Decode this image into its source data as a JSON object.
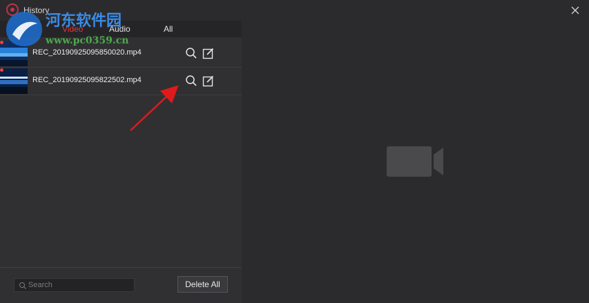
{
  "window": {
    "title": "History"
  },
  "tabs": [
    {
      "label": "Video",
      "active": true
    },
    {
      "label": "Audio",
      "active": false
    },
    {
      "label": "All",
      "active": false
    }
  ],
  "files": [
    {
      "name": "REC_20190925095850020.mp4"
    },
    {
      "name": "REC_20190925095822502.mp4"
    }
  ],
  "bottom": {
    "search_placeholder": "Search",
    "delete_all_label": "Delete All"
  },
  "watermark": {
    "text": "河东软件园",
    "url": "www.pc0359.cn"
  },
  "colors": {
    "accent": "#e8343a",
    "background": "#2b2b2d",
    "panel": "#303033"
  },
  "icons": [
    "app-logo-icon",
    "close-icon",
    "search-icon",
    "edit-icon",
    "video-camera-icon"
  ]
}
